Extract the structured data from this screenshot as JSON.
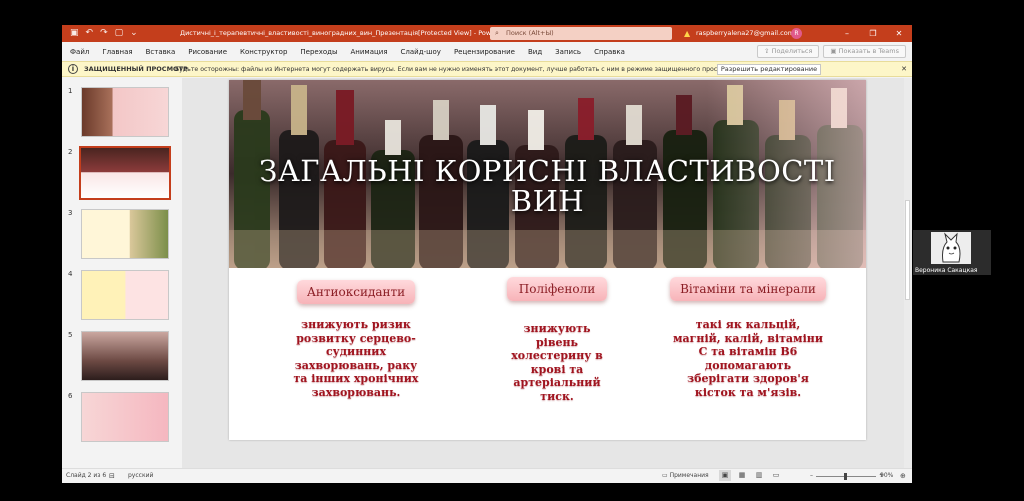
{
  "titlebar": {
    "doc_title": "Дистичні_і_терапевтичні_властивості_виноградних_вин_Презентація[Protected View]  -  PowerPoint",
    "search_placeholder": "Поиск (Alt+Ы)",
    "user_email": "raspberryalena27@gmail.com",
    "avatar_letter": "R"
  },
  "menu": {
    "items": [
      "Файл",
      "Главная",
      "Вставка",
      "Рисование",
      "Конструктор",
      "Переходы",
      "Анимация",
      "Слайд-шоу",
      "Рецензирование",
      "Вид",
      "Запись",
      "Справка"
    ],
    "share_label": "Поделиться",
    "teams_label": "Показать в Teams"
  },
  "protected_view": {
    "title": "ЗАЩИЩЕННЫЙ ПРОСМОТР",
    "message": "Будьте осторожны: файлы из Интернета могут содержать вирусы. Если вам не нужно изменять этот документ, лучше работать с ним в режиме защищенного просмотра.",
    "button": "Разрешить редактирование"
  },
  "thumbnails": [
    {
      "num": "1"
    },
    {
      "num": "2"
    },
    {
      "num": "3"
    },
    {
      "num": "4"
    },
    {
      "num": "5"
    },
    {
      "num": "6"
    }
  ],
  "slide": {
    "title_line1": "ЗАГАЛЬНІ КОРИСНІ ВЛАСТИВОСТІ",
    "title_line2": "ВИН",
    "col1_heading": "Антиоксиданти",
    "col1_text": "знижують ризик розвитку серцево-судинних захворювань, раку та інших хронічних захворювань.",
    "col2_heading": "Поліфеноли",
    "col2_text": "знижують рівень холестерину в крові та артеріальний тиск.",
    "col3_heading": "Вітаміни та мінерали",
    "col3_text": "такі як кальцій, магній, калій, вітаміни С та вітамін В6 допомагають зберігати здоров'я кісток та м'язів."
  },
  "status": {
    "slide_counter": "Слайд 2 из 6",
    "language": "русский",
    "notes_label": "Примечания",
    "zoom": "90%"
  },
  "participant": {
    "name": "Вероника Сакацкая"
  },
  "colors": {
    "ribbon": "#c43e1c",
    "accent_text": "#a0141f",
    "pill": "#f7b3b8"
  }
}
